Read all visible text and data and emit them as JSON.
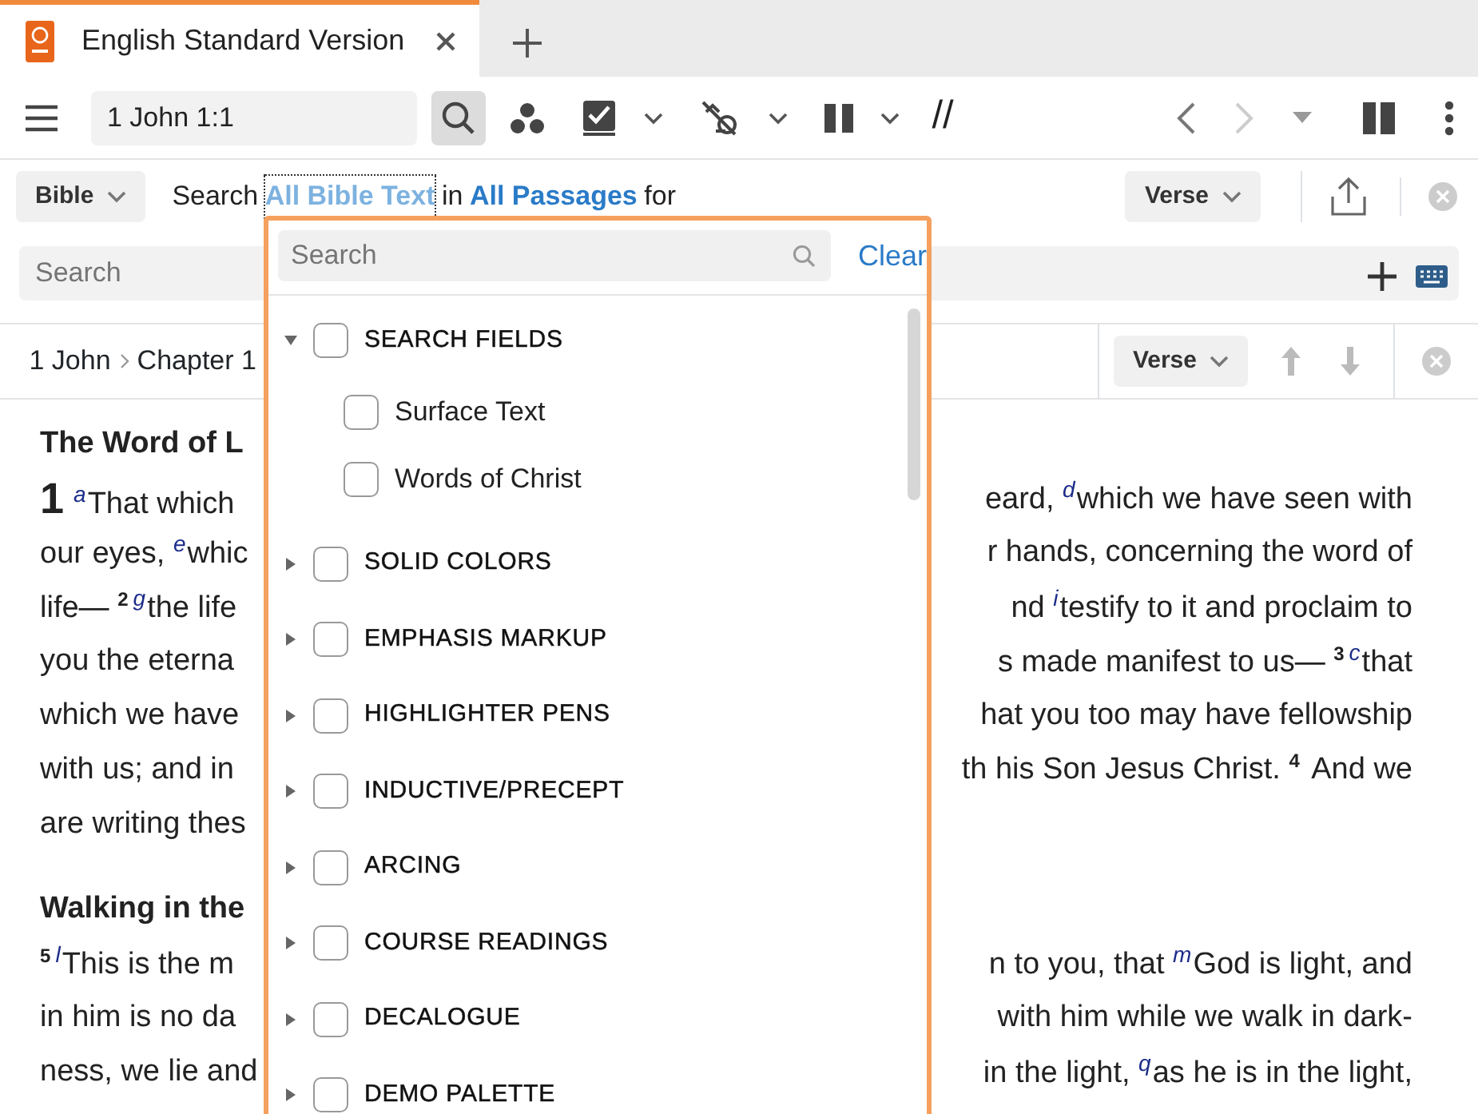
{
  "tab": {
    "title": "English Standard Version",
    "selected": true
  },
  "toolbar": {
    "reference": "1 John 1:1",
    "parallel_mark": "//"
  },
  "search_bar": {
    "scope_button": "Bible",
    "prefix": "Search",
    "field": "All Bible Text",
    "middle": "in",
    "range": "All Passages",
    "suffix": "for",
    "view_button": "Verse"
  },
  "search_input": {
    "placeholder": "Search"
  },
  "breadcrumb": {
    "items": [
      "1 John",
      "Chapter 1"
    ],
    "view_button": "Verse"
  },
  "passage": [
    {
      "kind": "heading",
      "left": [
        {
          "kind": "text",
          "text": "The Word of L"
        }
      ]
    },
    {
      "kind": "verse",
      "left": [
        {
          "kind": "chapter",
          "text": "1"
        },
        {
          "kind": "note",
          "text": "a"
        },
        {
          "kind": "text",
          "text": "That which"
        }
      ],
      "right": [
        {
          "kind": "text",
          "text": "eard, "
        },
        {
          "kind": "note",
          "text": "d"
        },
        {
          "kind": "text",
          "text": "which we have seen with"
        }
      ]
    },
    {
      "kind": "verse",
      "left": [
        {
          "kind": "text",
          "text": "our eyes, "
        },
        {
          "kind": "note",
          "text": "e"
        },
        {
          "kind": "text",
          "text": "whic"
        }
      ],
      "right": [
        {
          "kind": "text",
          "text": "r hands, concerning the word of"
        }
      ]
    },
    {
      "kind": "verse",
      "left": [
        {
          "kind": "text",
          "text": "life— "
        },
        {
          "kind": "number",
          "text": "2"
        },
        {
          "kind": "note",
          "text": "g"
        },
        {
          "kind": "text",
          "text": "the life"
        }
      ],
      "right": [
        {
          "kind": "text",
          "text": "nd "
        },
        {
          "kind": "note",
          "text": "i"
        },
        {
          "kind": "text",
          "text": "testify to it and proclaim to"
        }
      ]
    },
    {
      "kind": "verse",
      "left": [
        {
          "kind": "text",
          "text": "you the eterna"
        }
      ],
      "right": [
        {
          "kind": "text",
          "text": "s made manifest to us— "
        },
        {
          "kind": "number",
          "text": "3"
        },
        {
          "kind": "note",
          "text": "c"
        },
        {
          "kind": "text",
          "text": "that"
        }
      ]
    },
    {
      "kind": "verse",
      "left": [
        {
          "kind": "text",
          "text": "which we have"
        }
      ],
      "right": [
        {
          "kind": "text",
          "text": "hat you too may have fellowship"
        }
      ]
    },
    {
      "kind": "verse",
      "left": [
        {
          "kind": "text",
          "text": "with us; and in"
        }
      ],
      "right": [
        {
          "kind": "text",
          "text": "th his Son Jesus Christ. "
        },
        {
          "kind": "number",
          "text": "4"
        },
        {
          "kind": "text",
          "text": " And we"
        }
      ]
    },
    {
      "kind": "verse",
      "left": [
        {
          "kind": "text",
          "text": "are writing thes"
        }
      ]
    },
    {
      "kind": "heading",
      "left": [
        {
          "kind": "text",
          "text": "Walking in the"
        }
      ]
    },
    {
      "kind": "verse",
      "left": [
        {
          "kind": "number",
          "text": "5"
        },
        {
          "kind": "note",
          "text": "l"
        },
        {
          "kind": "text",
          "text": "This is the m"
        }
      ],
      "right": [
        {
          "kind": "text",
          "text": "n to you, that "
        },
        {
          "kind": "note",
          "text": "m"
        },
        {
          "kind": "text",
          "text": "God is light, and"
        }
      ]
    },
    {
      "kind": "verse",
      "left": [
        {
          "kind": "text",
          "text": "in him is no da"
        }
      ],
      "right": [
        {
          "kind": "text",
          "text": "with him while we walk in dark-"
        }
      ]
    },
    {
      "kind": "verse",
      "left": [
        {
          "kind": "text",
          "text": "ness, we lie and"
        }
      ],
      "right": [
        {
          "kind": "text",
          "text": "in the light, "
        },
        {
          "kind": "note",
          "text": "q"
        },
        {
          "kind": "text",
          "text": "as he is in the light,"
        }
      ]
    }
  ],
  "popup": {
    "search": {
      "placeholder": "Search"
    },
    "clear": "Clear",
    "items": [
      {
        "label": "SEARCH FIELDS",
        "expanded": true,
        "checked": false,
        "children": [
          {
            "label": "Surface Text",
            "checked": false
          },
          {
            "label": "Words of Christ",
            "checked": false
          }
        ]
      },
      {
        "label": "SOLID COLORS",
        "expanded": false,
        "checked": false
      },
      {
        "label": "EMPHASIS MARKUP",
        "expanded": false,
        "checked": false
      },
      {
        "label": "HIGHLIGHTER PENS",
        "expanded": false,
        "checked": false
      },
      {
        "label": "INDUCTIVE/PRECEPT",
        "expanded": false,
        "checked": false
      },
      {
        "label": "ARCING",
        "expanded": false,
        "checked": false
      },
      {
        "label": "COURSE READINGS",
        "expanded": false,
        "checked": false
      },
      {
        "label": "DECALOGUE",
        "expanded": false,
        "checked": false
      },
      {
        "label": "DEMO PALETTE",
        "expanded": false,
        "checked": false
      }
    ]
  }
}
